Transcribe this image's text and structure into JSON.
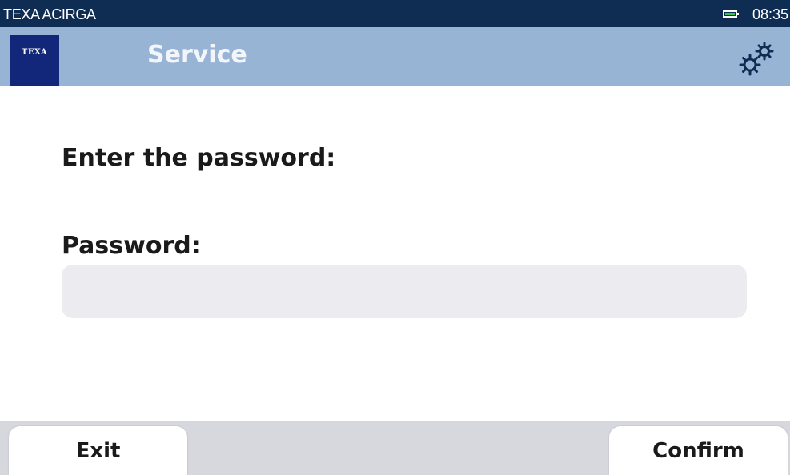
{
  "status_bar": {
    "app_name": "TEXA ACIRGA",
    "time": "08:35",
    "battery_icon": "battery-icon",
    "battery_color": "#3cc24a"
  },
  "header": {
    "logo_text": "TEXA",
    "title": "Service",
    "settings_icon": "gear-icon",
    "background_color": "#98b4d5"
  },
  "main": {
    "prompt": "Enter the password:",
    "password_label": "Password:",
    "password_value": "",
    "password_placeholder": ""
  },
  "footer": {
    "exit_label": "Exit",
    "confirm_label": "Confirm"
  }
}
